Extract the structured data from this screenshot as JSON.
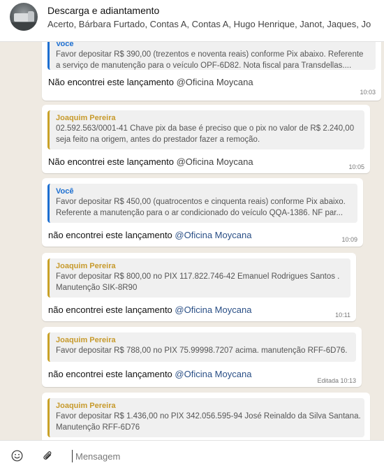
{
  "header": {
    "title": "Descarga e adiantamento",
    "members": "Acerto, Bárbara Furtado, Contas A, Contas A, Hugo Henrique, Janot, Jaques, Jo",
    "avatar_icon": "group-avatar-truck"
  },
  "messages": [
    {
      "quote_author": "Você",
      "quote_lines": [
        "Favor depositar R$ 390,00 (trezentos e noventa reais) conforme Pix abaixo. Referente",
        "a serviço de manutenção para o veículo OPF-6D82. Nota fiscal para Transdellas...."
      ],
      "text": "Não encontrei este lançamento ",
      "mention": "@Oficina Moycana",
      "time": "10:03"
    },
    {
      "quote_author": "Joaquim Pereira",
      "quote_lines": [
        "02.592.563/0001-41 Chave pix da base é preciso que o pix no valor de R$ 2.240,00",
        "seja feito na origem, antes do prestador fazer a remoção."
      ],
      "text": "Não encontrei este lançamento ",
      "mention": "@Oficina Moycana",
      "time": "10:05"
    },
    {
      "quote_author": "Você",
      "quote_lines": [
        "Favor depositar R$ 450,00 (quatrocentos e cinquenta reais) conforme Pix abaixo.",
        "Referente a manutenção para o ar condicionado do veículo QQA-1386. NF par..."
      ],
      "text": "não encontrei este lançamento ",
      "mention": "@Oficina Moycana",
      "time": "10:09"
    },
    {
      "quote_author": "Joaquim Pereira",
      "quote_lines": [
        "Favor depositar R$ 800,00 no PIX 117.822.746-42 Emanuel Rodrigues Santos .",
        "Manutenção SIK-8R90"
      ],
      "text": "não encontrei este lançamento ",
      "mention": "@Oficina Moycana",
      "time": "10:11"
    },
    {
      "quote_author": "Joaquim Pereira",
      "quote_lines": [
        "Favor depositar R$ 788,00 no PIX 75.99998.7207 acima. manutenção RFF-6D76."
      ],
      "text": "não encontrei este lançamento ",
      "mention": "@Oficina Moycana",
      "time": "Editada 10:13"
    },
    {
      "quote_author": "Joaquim Pereira",
      "quote_lines": [
        "Favor depositar R$ 1.436,00 no PIX 342.056.595-94 José Reinaldo da Silva Santana.",
        "Manutenção RFF-6D76"
      ]
    }
  ],
  "composer": {
    "placeholder": "Mensagem",
    "emoji_icon": "smiley-icon",
    "attach_icon": "paperclip-icon"
  },
  "colors": {
    "self_quote_accent": "#1d6fd1",
    "other_quote_accent": "#c9a227",
    "mention": "#2a4f86",
    "background": "#efeae2"
  }
}
